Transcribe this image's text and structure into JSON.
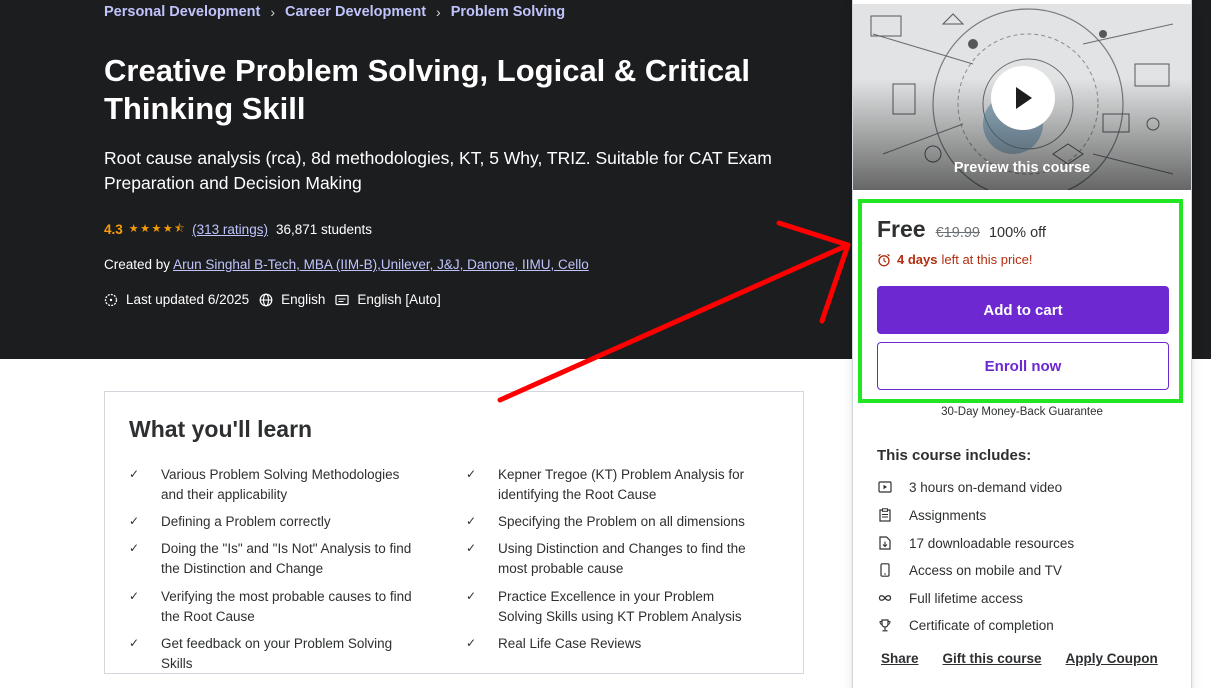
{
  "breadcrumb": [
    "Personal Development",
    "Career Development",
    "Problem Solving"
  ],
  "course": {
    "title": "Creative Problem Solving, Logical & Critical Thinking Skill",
    "subtitle": "Root cause analysis (rca), 8d methodologies, KT, 5 Why, TRIZ. Suitable for CAT Exam Preparation and Decision Making",
    "rating": "4.3",
    "rating_stars": 4.3,
    "ratings_count": "(313 ratings)",
    "students": "36,871 students",
    "created_by_label": "Created by",
    "instructor": "Arun Singhal B-Tech, MBA (IIM-B),Unilever, J&J, Danone, IIMU, Cello",
    "last_updated": "Last updated 6/2025",
    "language": "English",
    "captions": "English [Auto]"
  },
  "learn": {
    "title": "What you'll learn",
    "items": [
      "Various Problem Solving Methodologies and their applicability",
      "Kepner Tregoe (KT) Problem Analysis for identifying the Root Cause",
      "Defining a Problem correctly",
      "Specifying the Problem on all dimensions",
      "Doing the \"Is\" and \"Is Not\" Analysis to find the Distinction and Change",
      "Using Distinction and Changes to find the most probable cause",
      "Verifying the most probable causes to find the Root Cause",
      "Practice Excellence in your Problem Solving Skills using KT Problem Analysis",
      "Get feedback on your Problem Solving Skills",
      "Real Life Case Reviews"
    ]
  },
  "sidebar": {
    "preview_label": "Preview this course",
    "price": "Free",
    "original_price": "€19.99",
    "discount": "100% off",
    "timer_bold": "4 days",
    "timer_rest": "left at this price!",
    "add_to_cart": "Add to cart",
    "enroll_now": "Enroll now",
    "guarantee": "30-Day Money-Back Guarantee",
    "includes_title": "This course includes:",
    "includes": [
      {
        "icon": "video-icon",
        "text": "3 hours on-demand video"
      },
      {
        "icon": "assignment-icon",
        "text": "Assignments"
      },
      {
        "icon": "download-file-icon",
        "text": "17 downloadable resources"
      },
      {
        "icon": "mobile-icon",
        "text": "Access on mobile and TV"
      },
      {
        "icon": "infinity-icon",
        "text": "Full lifetime access"
      },
      {
        "icon": "trophy-icon",
        "text": "Certificate of completion"
      }
    ],
    "links": [
      "Share",
      "Gift this course",
      "Apply Coupon"
    ]
  },
  "colors": {
    "hero_bg": "#1c1d1f",
    "accent_purple": "#6d28d2",
    "link_lavender": "#c0c4fc",
    "star_orange": "#f69c08",
    "timer_red": "#b32d0f",
    "annotation_green": "#22e622",
    "annotation_red": "#ff0000"
  }
}
